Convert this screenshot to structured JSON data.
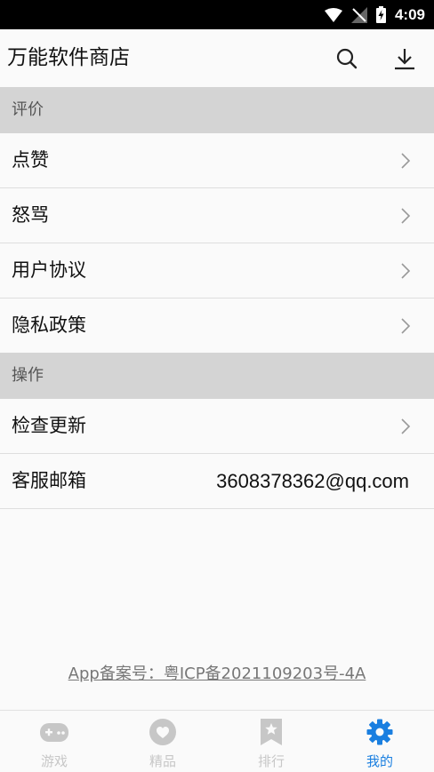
{
  "status_bar": {
    "time": "4:09"
  },
  "app_bar": {
    "title": "万能软件商店",
    "search_icon": "search-icon",
    "download_icon": "download-icon"
  },
  "sections": [
    {
      "header": "评价",
      "items": [
        {
          "label": "点赞"
        },
        {
          "label": "怒骂"
        },
        {
          "label": "用户协议"
        },
        {
          "label": "隐私政策"
        }
      ]
    },
    {
      "header": "操作",
      "items": [
        {
          "label": "检查更新"
        },
        {
          "label": "客服邮箱",
          "value": "3608378362@qq.com"
        }
      ]
    }
  ],
  "icp": "App备案号：粤ICP备2021109203号-4A",
  "bottom_nav": {
    "items": [
      {
        "label": "游戏",
        "icon": "gamepad-icon"
      },
      {
        "label": "精品",
        "icon": "heart-icon"
      },
      {
        "label": "排行",
        "icon": "bookmark-star-icon"
      },
      {
        "label": "我的",
        "icon": "gear-icon"
      }
    ],
    "active_index": 3
  },
  "colors": {
    "accent": "#1a7fe0",
    "section_bg": "#d4d4d4",
    "inactive": "#c7c7c7"
  }
}
